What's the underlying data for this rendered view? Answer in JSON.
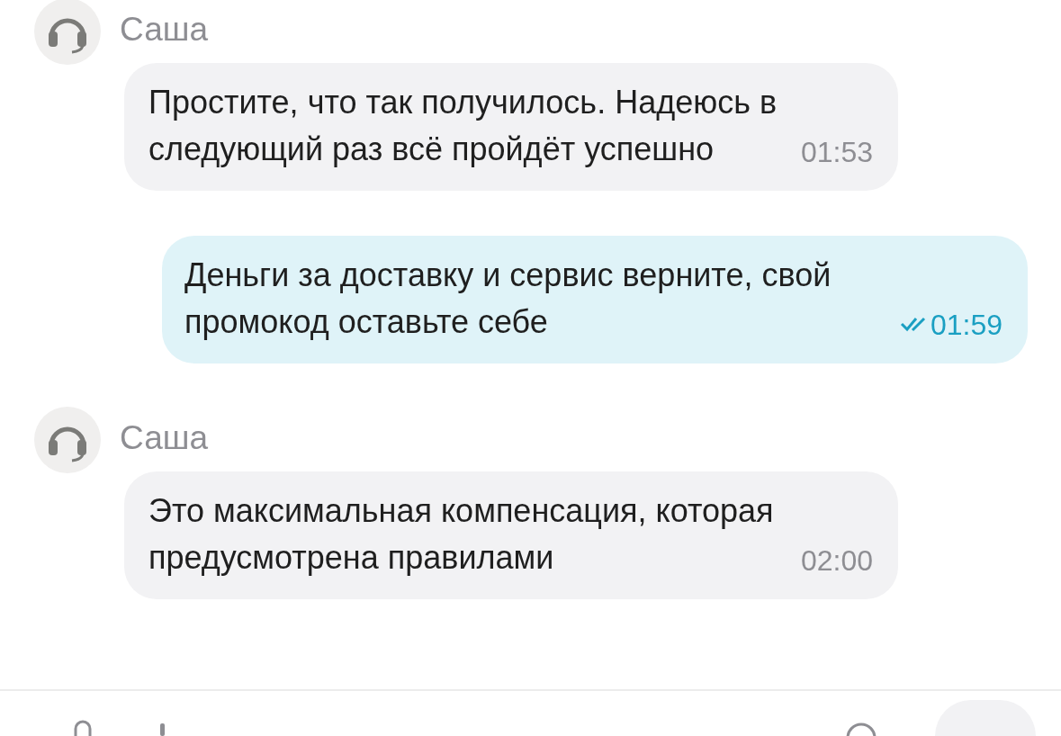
{
  "messages": [
    {
      "kind": "incoming",
      "sender": "Саша",
      "text": "Простите, что так получилось. Надеюсь в следующий раз всё пройдёт успешно",
      "time": "01:53"
    },
    {
      "kind": "outgoing",
      "text": "Деньги за доставку и сервис верните, свой промокод оставьте себе",
      "time": "01:59",
      "read": true
    },
    {
      "kind": "incoming",
      "sender": "Саша",
      "text": "Это максимальная компенсация, которая предусмотрена правилами",
      "time": "02:00"
    }
  ]
}
